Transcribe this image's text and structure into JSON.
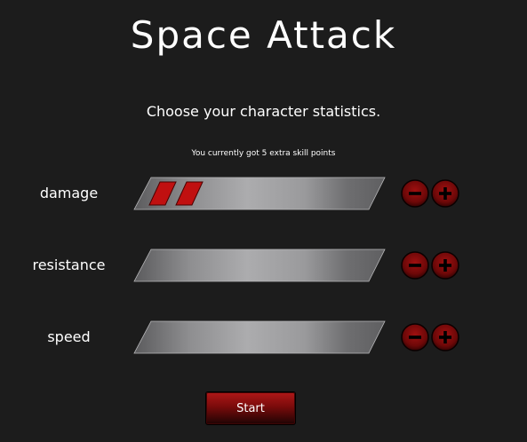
{
  "title": "Space Attack",
  "subtitle": "Choose your character statistics.",
  "points_info": "You currently got 5 extra skill points",
  "stats": [
    {
      "label": "damage",
      "points": 2
    },
    {
      "label": "resistance",
      "points": 0
    },
    {
      "label": "speed",
      "points": 0
    }
  ],
  "start_label": "Start",
  "colors": {
    "background": "#1c1c1c",
    "text": "#ffffff",
    "accent_red": "#c01010",
    "button_red_dark": "#3a0303"
  },
  "icons": {
    "decrease": "minus-icon",
    "increase": "plus-icon"
  }
}
